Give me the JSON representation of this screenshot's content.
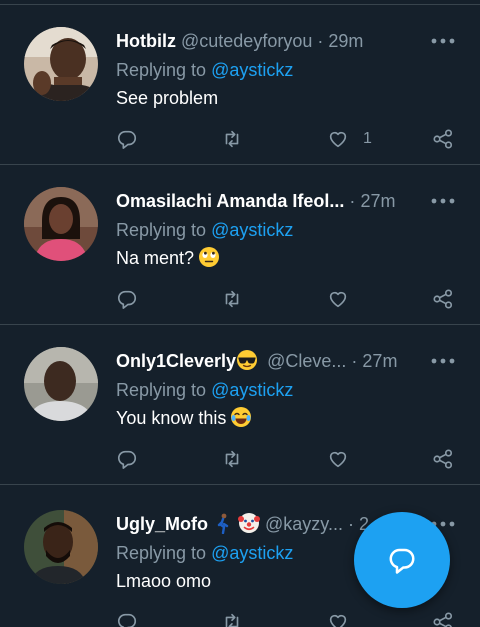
{
  "colors": {
    "background": "#15202b",
    "divider": "#38444d",
    "secondary_text": "#8899a6",
    "accent": "#1da1f2",
    "primary_text": "#ffffff"
  },
  "tweets": [
    {
      "display_name": "Hotbilz ",
      "handle": "@cutedeyforyou",
      "time": "29m",
      "replying_prefix": "Replying to",
      "reply_to": "@aystickz",
      "text": "See problem",
      "like_count": "1",
      "emoji_icon": ""
    },
    {
      "display_name": "Omasilachi Amanda Ifeol...",
      "handle": "",
      "time": "27m",
      "replying_prefix": "Replying to",
      "reply_to": "@aystickz",
      "text": "Na ment?",
      "like_count": "",
      "emoji_icon": "eye-roll-emoji"
    },
    {
      "display_name": "Only1Cleverly",
      "handle": "@Cleve...",
      "time": "27m",
      "replying_prefix": "Replying to",
      "reply_to": "@aystickz",
      "text": "You know this",
      "like_count": "",
      "emoji_icon": "laughing-tears-emoji"
    },
    {
      "display_name": "Ugly_Mofo",
      "handle": "@kayzy...",
      "time": "2",
      "replying_prefix": "Replying to",
      "reply_to": "@aystickz",
      "text": "Lmaoo omo",
      "like_count": "",
      "emoji_icon": ""
    }
  ],
  "separator_dot": "·",
  "icons": {
    "reply": "reply-icon",
    "retweet": "retweet-icon",
    "like": "heart-icon",
    "share": "share-icon",
    "more": "more-icon",
    "compose": "compose-reply-icon"
  }
}
